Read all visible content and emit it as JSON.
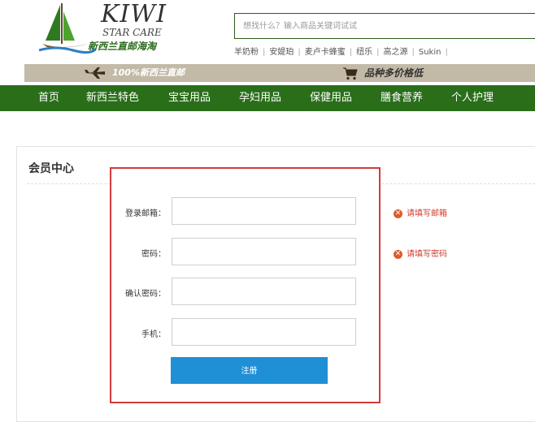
{
  "logo": {
    "brand": "KIWI",
    "sub": "STAR CARE",
    "cn": "新西兰直邮海淘"
  },
  "search": {
    "placeholder": "想找什么？输入商品关键词试试"
  },
  "hotwords": [
    "羊奶粉",
    "安媞珀",
    "麦卢卡蜂蜜",
    "纽乐",
    "高之源",
    "Sukin"
  ],
  "banner": {
    "left_text": "100%新西兰直邮",
    "right_text": "品种多价格低"
  },
  "nav": {
    "items": [
      {
        "label": "首页"
      },
      {
        "label": "新西兰特色"
      },
      {
        "label": "宝宝用品"
      },
      {
        "label": "孕妇用品"
      },
      {
        "label": "保健用品"
      },
      {
        "label": "膳食营养"
      },
      {
        "label": "个人护理"
      }
    ]
  },
  "member": {
    "title": "会员中心",
    "fields": [
      {
        "label": "登录邮箱：",
        "value": "",
        "error": "请填写邮箱"
      },
      {
        "label": "密码：",
        "value": "",
        "error": "请填写密码"
      },
      {
        "label": "确认密码：",
        "value": ""
      },
      {
        "label": "手机：",
        "value": ""
      }
    ],
    "submit_label": "注册"
  },
  "colors": {
    "nav_green": "#2a6e1a",
    "banner_tan": "#c2b9a7",
    "form_border_red": "#d43b3b",
    "submit_blue": "#1f8fd6",
    "error_red": "#d03a2b"
  }
}
